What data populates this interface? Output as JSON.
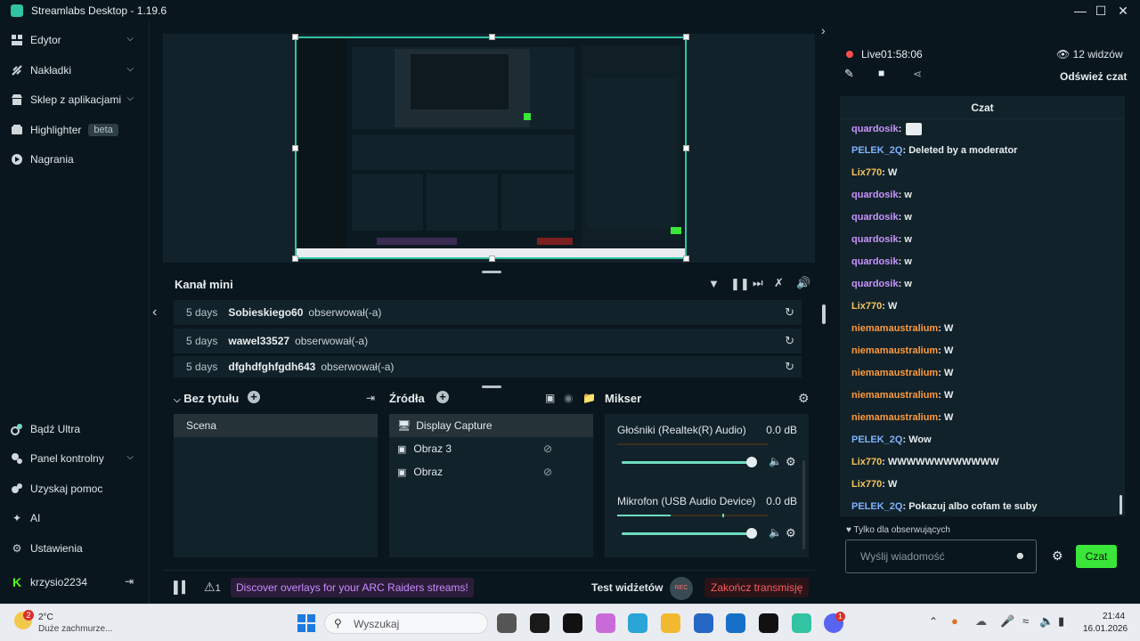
{
  "window": {
    "title": "Streamlabs Desktop - 1.19.6"
  },
  "sidebar": {
    "items": [
      {
        "label": "Edytor",
        "icon": "editor-icon",
        "has_chevron": true
      },
      {
        "label": "Nakładki",
        "icon": "overlays-icon",
        "has_chevron": true
      },
      {
        "label": "Sklep z aplikacjami",
        "icon": "app-store-icon",
        "has_chevron": true
      },
      {
        "label": "Highlighter",
        "icon": "highlighter-icon",
        "badge": "beta"
      },
      {
        "label": "Nagrania",
        "icon": "recordings-icon"
      }
    ],
    "bottom_items": [
      {
        "label": "Bądź Ultra",
        "icon": "ultra-icon"
      },
      {
        "label": "Panel kontrolny",
        "icon": "dashboard-icon",
        "has_chevron": true
      },
      {
        "label": "Uzyskaj pomoc",
        "icon": "help-icon"
      },
      {
        "label": "AI",
        "icon": "ai-sparkle-icon"
      },
      {
        "label": "Ustawienia",
        "icon": "gear-icon"
      }
    ],
    "user": {
      "name": "krzysio2234",
      "icon": "kick-logo-icon"
    }
  },
  "minifeed": {
    "title": "Kanał mini",
    "events": [
      {
        "age": "5 days",
        "user": "Sobieskiego60",
        "action": "obserwował(-a)"
      },
      {
        "age": "5 days",
        "user": "wawel33527",
        "action": "obserwował(-a)"
      },
      {
        "age": "5 days",
        "user": "dfghdfghfgdh643",
        "action": "obserwował(-a)"
      }
    ]
  },
  "scenes": {
    "title": "Bez tytułu",
    "items": [
      "Scena"
    ]
  },
  "sources": {
    "title": "Źródła",
    "items": [
      {
        "label": "Display Capture",
        "icon": "monitor-icon",
        "selected": true
      },
      {
        "label": "Obraz 3",
        "icon": "image-icon",
        "hidden": true
      },
      {
        "label": "Obraz",
        "icon": "image-icon",
        "hidden": true
      }
    ]
  },
  "mixer": {
    "title": "Mikser",
    "channels": [
      {
        "name": "Głośniki (Realtek(R) Audio)",
        "db": "0.0 dB",
        "level": 1.0
      },
      {
        "name": "Mikrofon (USB Audio Device)",
        "db": "0.0 dB",
        "level": 1.0
      }
    ]
  },
  "footer": {
    "alerts_count": "1",
    "promo": "Discover overlays for your ARC Raiders streams!",
    "test_widgets": "Test widżetów",
    "rec": "REC",
    "end_stream": "Zakończ transmisję"
  },
  "live": {
    "label": "Live",
    "time": "01:58:06",
    "viewers": "12 widzów",
    "refresh_chat": "Odśwież czat"
  },
  "chat": {
    "title": "Czat",
    "messages": [
      {
        "user": "quardosik",
        "text": "",
        "color": "#c894ff",
        "emote": true
      },
      {
        "user": "PELEK_2Q",
        "text": "Deleted by a moderator",
        "color": "#7fb2ff"
      },
      {
        "user": "Lix770",
        "text": "W",
        "color": "#f6c45a"
      },
      {
        "user": "quardosik",
        "text": "w",
        "color": "#c894ff"
      },
      {
        "user": "quardosik",
        "text": "w",
        "color": "#c894ff"
      },
      {
        "user": "quardosik",
        "text": "w",
        "color": "#c894ff"
      },
      {
        "user": "quardosik",
        "text": "w",
        "color": "#c894ff"
      },
      {
        "user": "quardosik",
        "text": "w",
        "color": "#c894ff"
      },
      {
        "user": "Lix770",
        "text": "W",
        "color": "#f6c45a"
      },
      {
        "user": "niemamaustralium",
        "text": "W",
        "color": "#ff9a3c"
      },
      {
        "user": "niemamaustralium",
        "text": "W",
        "color": "#ff9a3c"
      },
      {
        "user": "niemamaustralium",
        "text": "W",
        "color": "#ff9a3c"
      },
      {
        "user": "niemamaustralium",
        "text": "W",
        "color": "#ff9a3c"
      },
      {
        "user": "niemamaustralium",
        "text": "W",
        "color": "#ff9a3c"
      },
      {
        "user": "PELEK_2Q",
        "text": "Wow",
        "color": "#7fb2ff"
      },
      {
        "user": "Lix770",
        "text": "WWWWWWWWWWWW",
        "color": "#f6c45a"
      },
      {
        "user": "Lix770",
        "text": "W",
        "color": "#f6c45a"
      },
      {
        "user": "PELEK_2Q",
        "text": "Pokazuj albo cofam te suby",
        "color": "#7fb2ff"
      }
    ],
    "followers_only": "Tylko dla obserwujących",
    "input_placeholder": "Wyślij wiadomość",
    "send_label": "Czat"
  },
  "taskbar": {
    "weather_temp": "2°C",
    "weather_desc": "Duże zachmurze...",
    "weather_badge": "2",
    "search_placeholder": "Wyszukaj",
    "time": "21:44",
    "date": "16.01.2026",
    "discord_badge": "1"
  },
  "colors": {
    "accent": "#31c3a2",
    "end_stream": "#ff5b5b",
    "promo_bg": "#2b1d3a",
    "promo_text": "#c98bff",
    "send_btn": "#39e639"
  }
}
